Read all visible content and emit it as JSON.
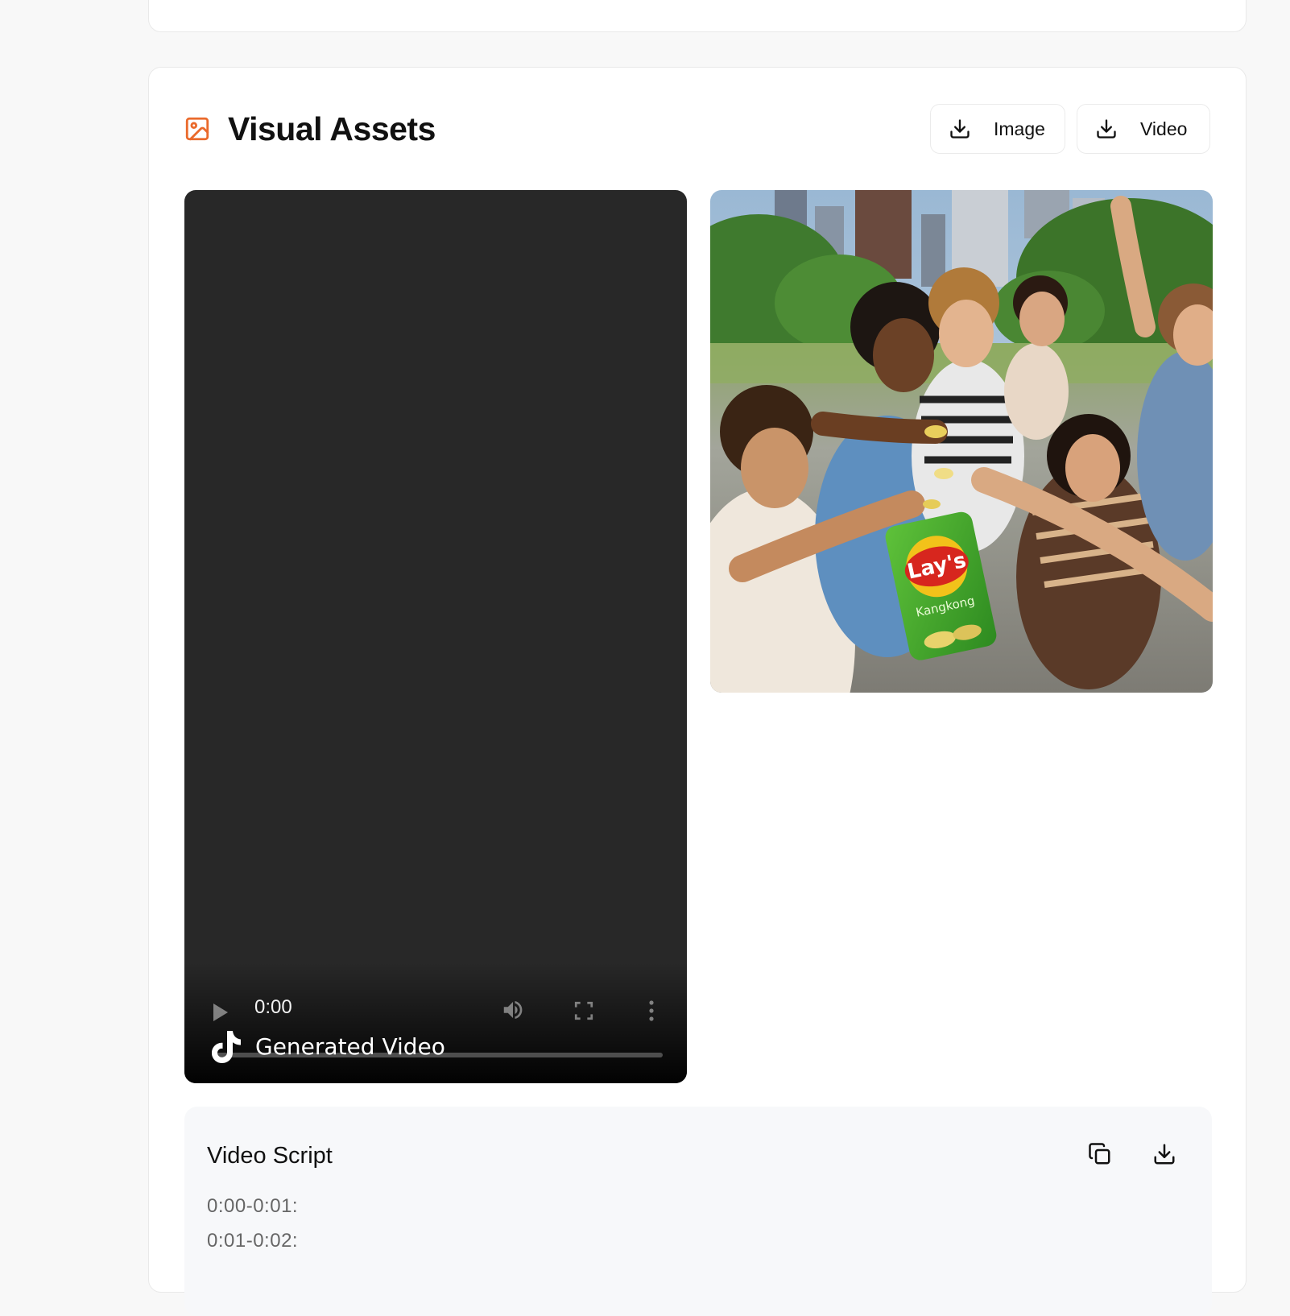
{
  "section": {
    "title": "Visual Assets",
    "icon": "image-icon",
    "accent_color": "#ea6a2c"
  },
  "actions": {
    "image_label": "Image",
    "video_label": "Video",
    "download_icon": "download-icon"
  },
  "video_player": {
    "current_time": "0:00",
    "progress": 0,
    "caption": "Generated Video",
    "caption_icon": "tiktok-icon"
  },
  "image_preview": {
    "package_brand": "Lay's",
    "package_flavor": "Kangkong"
  },
  "video_script": {
    "title": "Video Script",
    "lines": [
      "0:00-0:01:",
      "0:01-0:02:"
    ]
  }
}
